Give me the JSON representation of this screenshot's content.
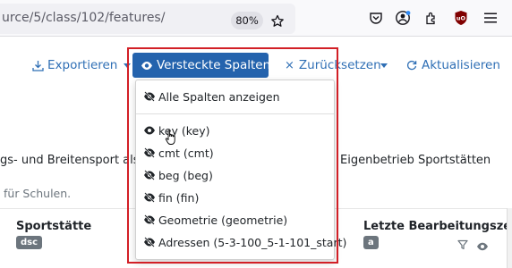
{
  "browser": {
    "url": "urce/5/class/102/features/",
    "zoom": "80%",
    "icons": [
      "bookmark-star-icon",
      "pocket-icon",
      "account-icon",
      "extensions-icon",
      "ublock-icon",
      "menu-icon"
    ]
  },
  "toolbar": {
    "export_label": "Exportieren",
    "hidden_columns_label": "Versteckte Spalten",
    "reset_label": "Zurücksetzen",
    "refresh_label": "Aktualisieren"
  },
  "content": {
    "line_left": "gs- und Breitensport als a",
    "line_right": "Eigenbetrieb Sportstätten",
    "note": "für Schulen."
  },
  "dropdown": {
    "show_all_label": "Alle Spalten anzeigen",
    "items": [
      {
        "label": "key (key)",
        "visible": true
      },
      {
        "label": "cmt (cmt)",
        "visible": false
      },
      {
        "label": "beg (beg)",
        "visible": false
      },
      {
        "label": "fin (fin)",
        "visible": false
      },
      {
        "label": "Geometrie (geometrie)",
        "visible": false
      },
      {
        "label": "Adressen (5-3-100_5-1-101_start)",
        "visible": false
      }
    ]
  },
  "table": {
    "col_sportstaette": {
      "label": "Sportstätte",
      "badge": "dsc"
    },
    "col_last_edit": {
      "label": "Letzte Bearbeitungszeit",
      "badge": "a"
    }
  },
  "colors": {
    "accent": "#2463ad",
    "link": "#2f6fb5",
    "highlight_border": "#d21f26"
  }
}
